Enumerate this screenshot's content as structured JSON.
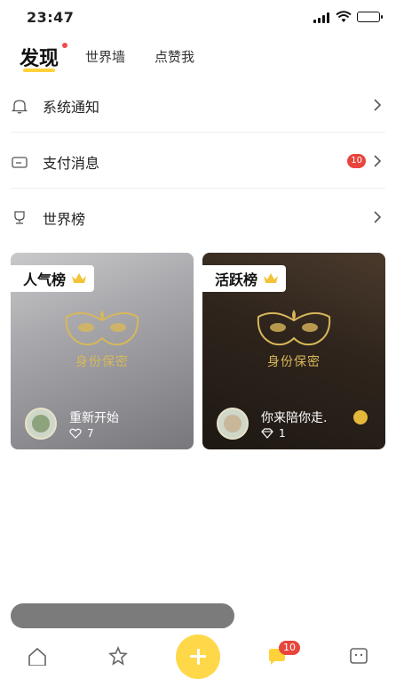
{
  "status": {
    "time": "23:47"
  },
  "tabs": [
    {
      "label": "发现"
    },
    {
      "label": "世界墙"
    },
    {
      "label": "点赞我"
    }
  ],
  "list": [
    {
      "label": "系统通知",
      "icon": "bell-icon"
    },
    {
      "label": "支付消息",
      "icon": "wallet-icon",
      "badge": "10"
    },
    {
      "label": "世界榜",
      "icon": "trophy-icon"
    }
  ],
  "cards": [
    {
      "tag": "人气榜",
      "mask_text": "身份保密",
      "user": "重新开始",
      "stat_icon": "heart-icon",
      "stat": "7"
    },
    {
      "tag": "活跃榜",
      "mask_text": "身份保密",
      "user": "你来陪你走.",
      "stat_icon": "diamond-icon",
      "stat": "1"
    }
  ],
  "nav": {
    "message_badge": "10"
  },
  "colors": {
    "accent": "#ffd23a",
    "badge": "#e8453c",
    "gold": "#d8b75a"
  }
}
